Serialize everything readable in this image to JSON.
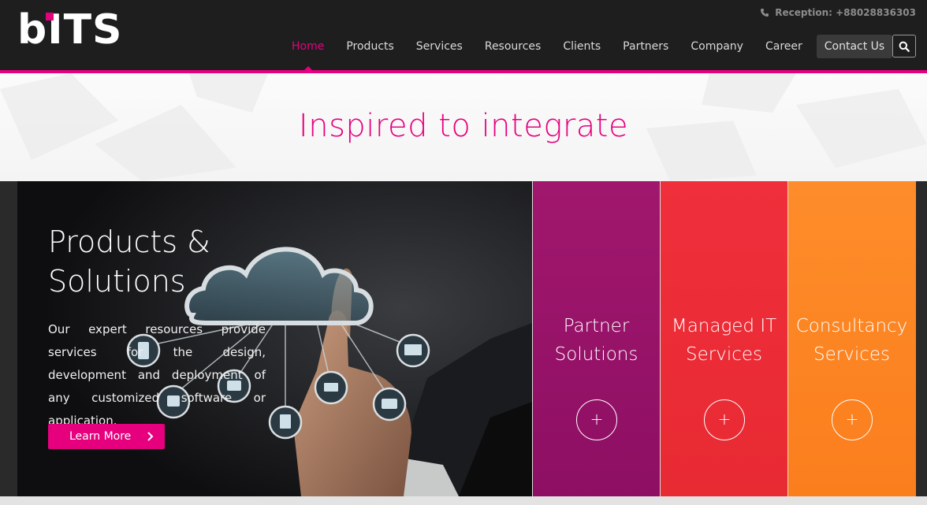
{
  "brand": {
    "logo_text": "bITS",
    "accent": "#e6007e"
  },
  "header": {
    "reception": "Reception: +88028836303",
    "nav": [
      {
        "label": "Home",
        "active": true
      },
      {
        "label": "Products"
      },
      {
        "label": "Services"
      },
      {
        "label": "Resources"
      },
      {
        "label": "Clients"
      },
      {
        "label": "Partners"
      },
      {
        "label": "Company"
      },
      {
        "label": "Career"
      },
      {
        "label": "Contact Us"
      }
    ],
    "search_icon": "search-icon"
  },
  "tagline": "Inspired to integrate",
  "hero": {
    "title_line1": "Products &",
    "title_line2": "Solutions",
    "text": "Our expert resources provide services for the design, development and deployment of any customized software or application.",
    "button": "Learn More"
  },
  "panels": [
    {
      "line1": "Partner",
      "line2": "Solutions",
      "color": "#9a136a",
      "icon": "plus-icon"
    },
    {
      "line1": "Managed IT",
      "line2": "Services",
      "color": "#ec2d37",
      "icon": "plus-icon"
    },
    {
      "line1": "Consultancy",
      "line2": "Services",
      "color": "#fd8624",
      "icon": "plus-icon"
    }
  ]
}
